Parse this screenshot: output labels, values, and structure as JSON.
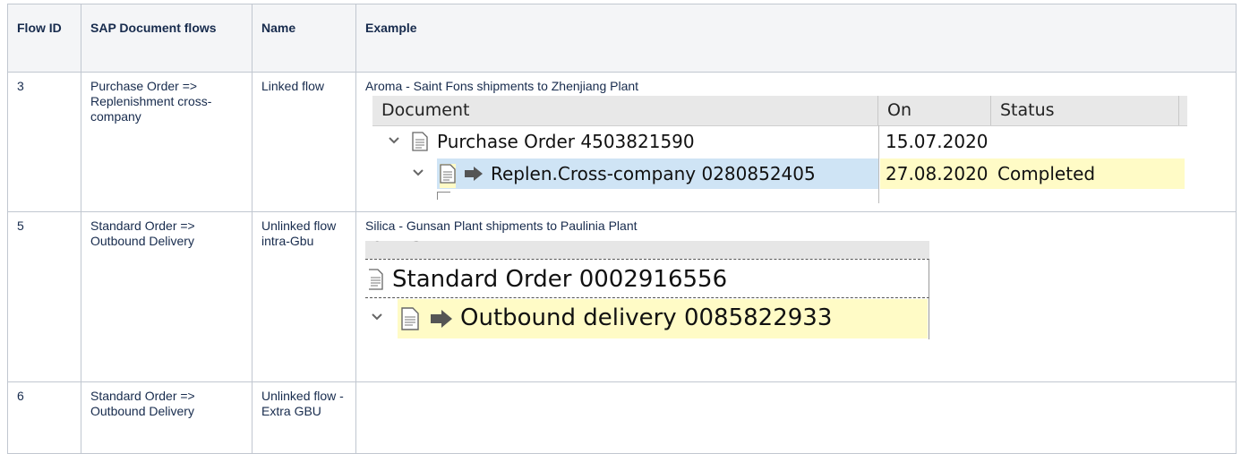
{
  "table": {
    "headers": [
      "Flow ID",
      "SAP Document flows",
      "Name",
      "Example"
    ],
    "rows": [
      {
        "id": "3",
        "flow": "Purchase Order => Replenishment cross-company",
        "name": "Linked flow",
        "example_caption": "Aroma - Saint Fons shipments to Zhenjiang Plant"
      },
      {
        "id": "5",
        "flow": "Standard Order => Outbound Delivery",
        "name": "Unlinked flow intra-Gbu",
        "example_caption": "Silica - Gunsan Plant shipments to Paulinia Plant"
      },
      {
        "id": "6",
        "flow": "Standard Order => Outbound Delivery",
        "name": "Unlinked flow - Extra GBU",
        "example_caption": ""
      }
    ]
  },
  "sap1": {
    "columns": [
      "Document",
      "On",
      "Status"
    ],
    "rows": [
      {
        "label": "Purchase Order 4503821590",
        "on": "15.07.2020",
        "status": ""
      },
      {
        "label": "Replen.Cross-company 0280852405",
        "on": "27.08.2020",
        "status": "Completed"
      }
    ]
  },
  "sap2": {
    "header": "ument",
    "rows": [
      {
        "label": "Standard Order 0002916556"
      },
      {
        "label": "Outbound delivery 0085822933"
      }
    ]
  },
  "colors": {
    "header_bg": "#f4f5f7",
    "border": "#c1c7d0",
    "highlight_blue": "#cfe4f5",
    "highlight_yellow": "#fffbc6"
  }
}
